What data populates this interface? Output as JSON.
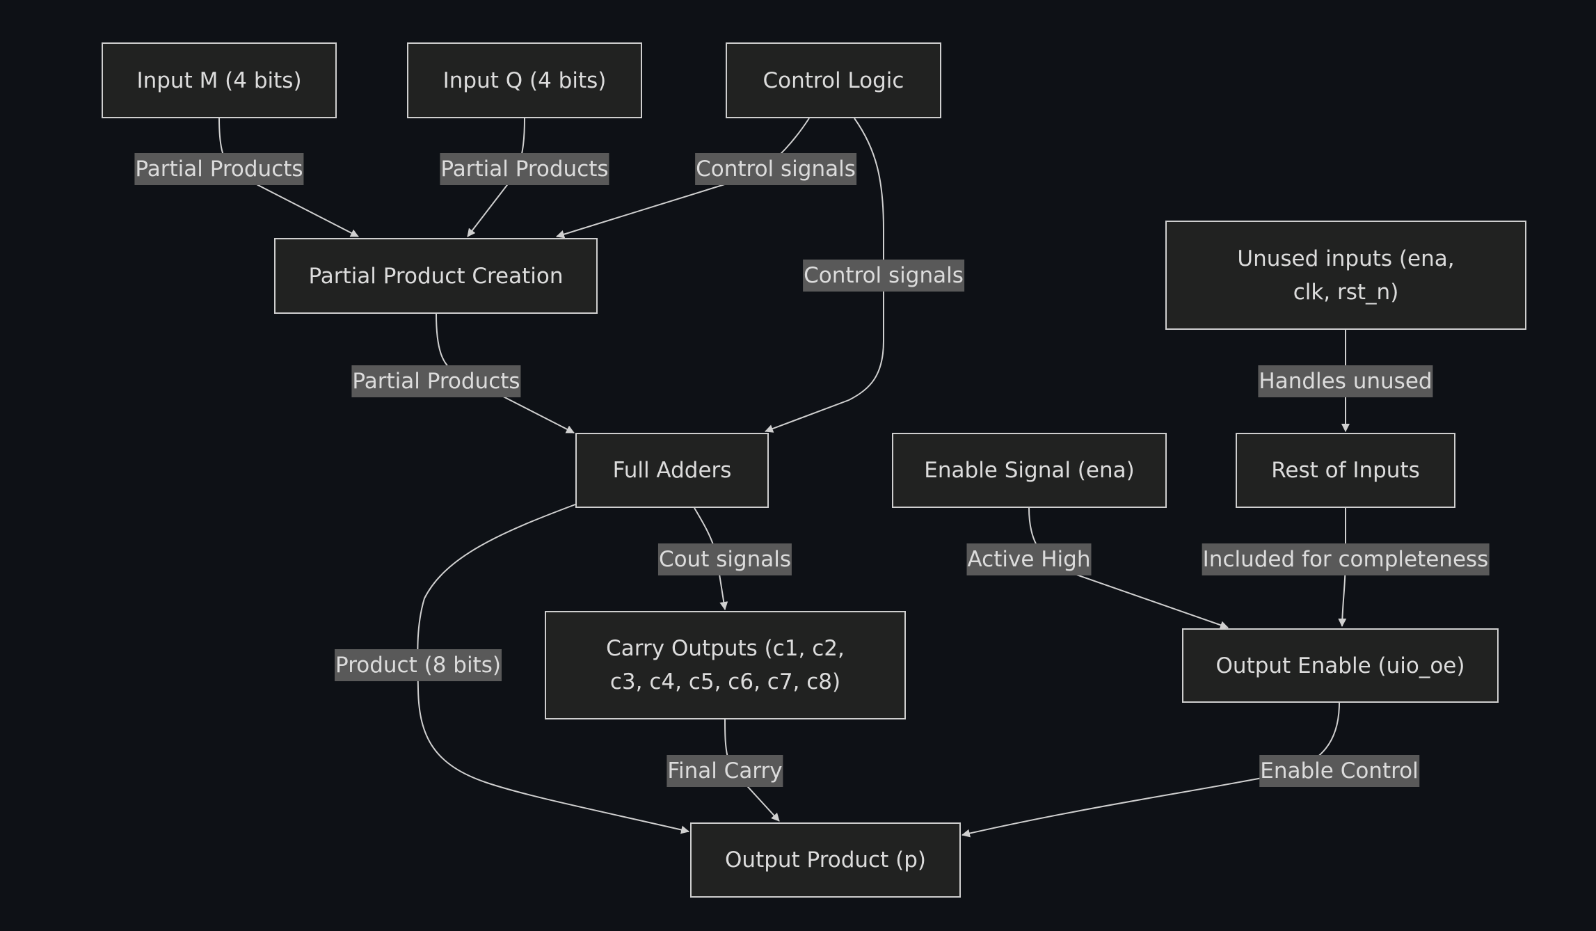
{
  "nodes": {
    "input_m": "Input M (4 bits)",
    "input_q": "Input Q (4 bits)",
    "control_logic": "Control Logic",
    "partial_product_creation": "Partial Product Creation",
    "unused_inputs": "Unused inputs (ena, clk, rst_n)",
    "full_adders": "Full Adders",
    "enable_signal": "Enable Signal (ena)",
    "rest_of_inputs": "Rest of Inputs",
    "carry_outputs": "Carry Outputs (c1, c2, c3, c4, c5, c6, c7, c8)",
    "output_enable": "Output Enable (uio_oe)",
    "output_product": "Output Product (p)"
  },
  "edges": [
    {
      "from": "input_m",
      "to": "partial_product_creation",
      "label": "Partial Products"
    },
    {
      "from": "input_q",
      "to": "partial_product_creation",
      "label": "Partial Products"
    },
    {
      "from": "control_logic",
      "to": "partial_product_creation",
      "label": "Control signals"
    },
    {
      "from": "control_logic",
      "to": "full_adders",
      "label": "Control signals"
    },
    {
      "from": "partial_product_creation",
      "to": "full_adders",
      "label": "Partial Products"
    },
    {
      "from": "unused_inputs",
      "to": "rest_of_inputs",
      "label": "Handles unused"
    },
    {
      "from": "full_adders",
      "to": "carry_outputs",
      "label": "Cout signals"
    },
    {
      "from": "full_adders",
      "to": "output_product",
      "label": "Product (8 bits)"
    },
    {
      "from": "enable_signal",
      "to": "output_enable",
      "label": "Active High"
    },
    {
      "from": "rest_of_inputs",
      "to": "output_enable",
      "label": "Included for completeness"
    },
    {
      "from": "carry_outputs",
      "to": "output_product",
      "label": "Final Carry"
    },
    {
      "from": "output_enable",
      "to": "output_product",
      "label": "Enable Control"
    }
  ]
}
